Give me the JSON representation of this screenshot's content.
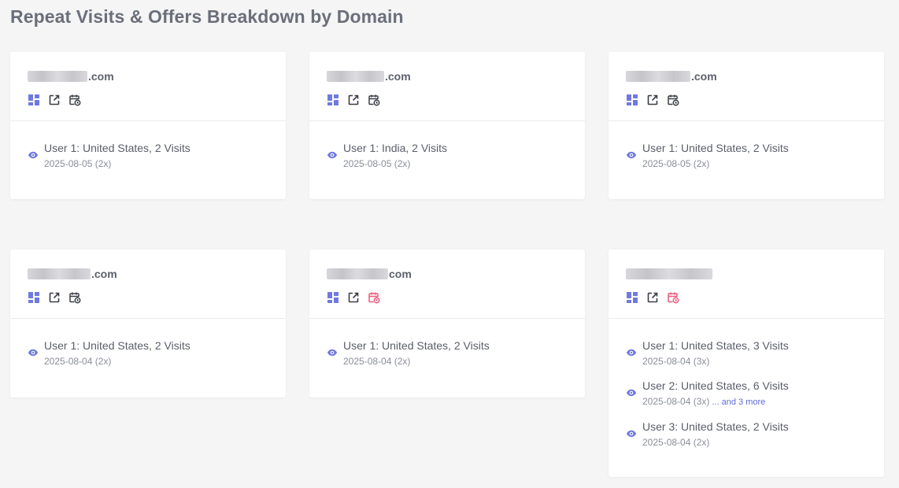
{
  "page": {
    "title": "Repeat Visits & Offers Breakdown by Domain"
  },
  "colors": {
    "accent": "#6f7ae0",
    "alert": "#ee5a7a",
    "icon_dark": "#3b3e46"
  },
  "cards": [
    {
      "domain_suffix": ".com",
      "calendar_icon": "calendar-clock-icon",
      "visits": [
        {
          "title": "User 1: United States, 2 Visits",
          "sub": "2025-08-05 (2x)",
          "more": ""
        }
      ]
    },
    {
      "domain_suffix": ".com",
      "calendar_icon": "calendar-clock-icon",
      "visits": [
        {
          "title": "User 1: India, 2 Visits",
          "sub": "2025-08-05 (2x)",
          "more": ""
        }
      ]
    },
    {
      "domain_suffix": ".com",
      "calendar_icon": "calendar-clock-icon",
      "visits": [
        {
          "title": "User 1: United States, 2 Visits",
          "sub": "2025-08-05 (2x)",
          "more": ""
        }
      ]
    },
    {
      "domain_suffix": ".com",
      "calendar_icon": "calendar-clock-icon",
      "visits": [
        {
          "title": "User 1: United States, 2 Visits",
          "sub": "2025-08-04 (2x)",
          "more": ""
        }
      ]
    },
    {
      "domain_suffix": "com",
      "calendar_icon": "calendar-clock-alert-icon",
      "visits": [
        {
          "title": "User 1: United States, 2 Visits",
          "sub": "2025-08-04 (2x)",
          "more": ""
        }
      ]
    },
    {
      "domain_suffix": "",
      "calendar_icon": "calendar-clock-alert-icon",
      "visits": [
        {
          "title": "User 1: United States, 3 Visits",
          "sub": "2025-08-04 (3x)",
          "more": ""
        },
        {
          "title": "User 2: United States, 6 Visits",
          "sub": "2025-08-04 (3x)",
          "more": "... and 3 more"
        },
        {
          "title": "User 3: United States, 2 Visits",
          "sub": "2025-08-04 (2x)",
          "more": ""
        }
      ]
    }
  ]
}
